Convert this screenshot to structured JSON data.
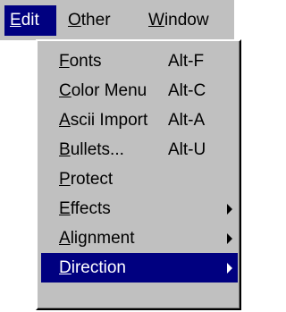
{
  "menubar": {
    "items": [
      {
        "mnemonic": "E",
        "rest": "dit",
        "active": true
      },
      {
        "mnemonic": "O",
        "rest": "ther",
        "active": false
      },
      {
        "mnemonic": "W",
        "rest": "indow",
        "active": false
      }
    ]
  },
  "menu": {
    "items": [
      {
        "mnemonic": "F",
        "rest": "onts",
        "shortcut": "Alt-F"
      },
      {
        "mnemonic": "C",
        "rest": "olor Menu",
        "shortcut": "Alt-C"
      },
      {
        "mnemonic": "A",
        "rest": "scii Import",
        "shortcut": "Alt-A"
      },
      {
        "mnemonic": "B",
        "rest": "ullets...",
        "shortcut": "Alt-U"
      },
      {
        "mnemonic": "P",
        "rest": "rotect"
      },
      {
        "mnemonic": "E",
        "rest": "ffects",
        "submenu": "submenu-arrow-icon"
      },
      {
        "mnemonic": "A",
        "rest": "lignment",
        "submenu": "submenu-arrow-icon"
      },
      {
        "mnemonic": "D",
        "rest": "irection",
        "submenu": "submenu-arrow-icon",
        "selected": true
      }
    ]
  },
  "colors": {
    "menu_background": "#c0c0c0",
    "highlight": "#000080",
    "highlight_text": "#ffffff"
  }
}
